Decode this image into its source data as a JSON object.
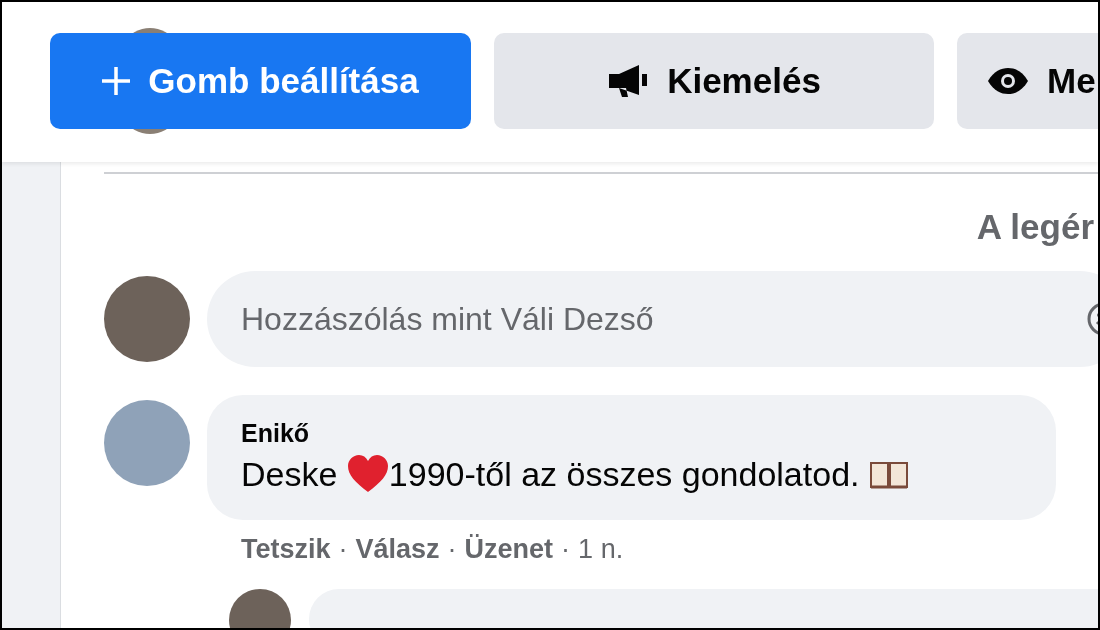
{
  "action_buttons": [
    {
      "kind": "primary",
      "label": "Gomb beállítása"
    },
    {
      "kind": "promote",
      "label": "Kiemelés"
    },
    {
      "kind": "view",
      "label": "Me"
    }
  ],
  "sort_label": "A legér",
  "composer": {
    "placeholder": "Hozzászólás mint Váli Dezső"
  },
  "comments": [
    {
      "author": "Enikő",
      "text_parts": [
        "Deske",
        "1990-től az összes gondolatod."
      ],
      "action_row": [
        {
          "kind": "link",
          "text": "Tetszik"
        },
        {
          "kind": "dot",
          "text": "·"
        },
        {
          "kind": "link",
          "text": "Válasz"
        },
        {
          "kind": "dot",
          "text": "·"
        },
        {
          "kind": "link",
          "text": "Üzenet"
        },
        {
          "kind": "dot",
          "text": "·"
        },
        {
          "kind": "time",
          "text": "1 n."
        }
      ]
    }
  ]
}
